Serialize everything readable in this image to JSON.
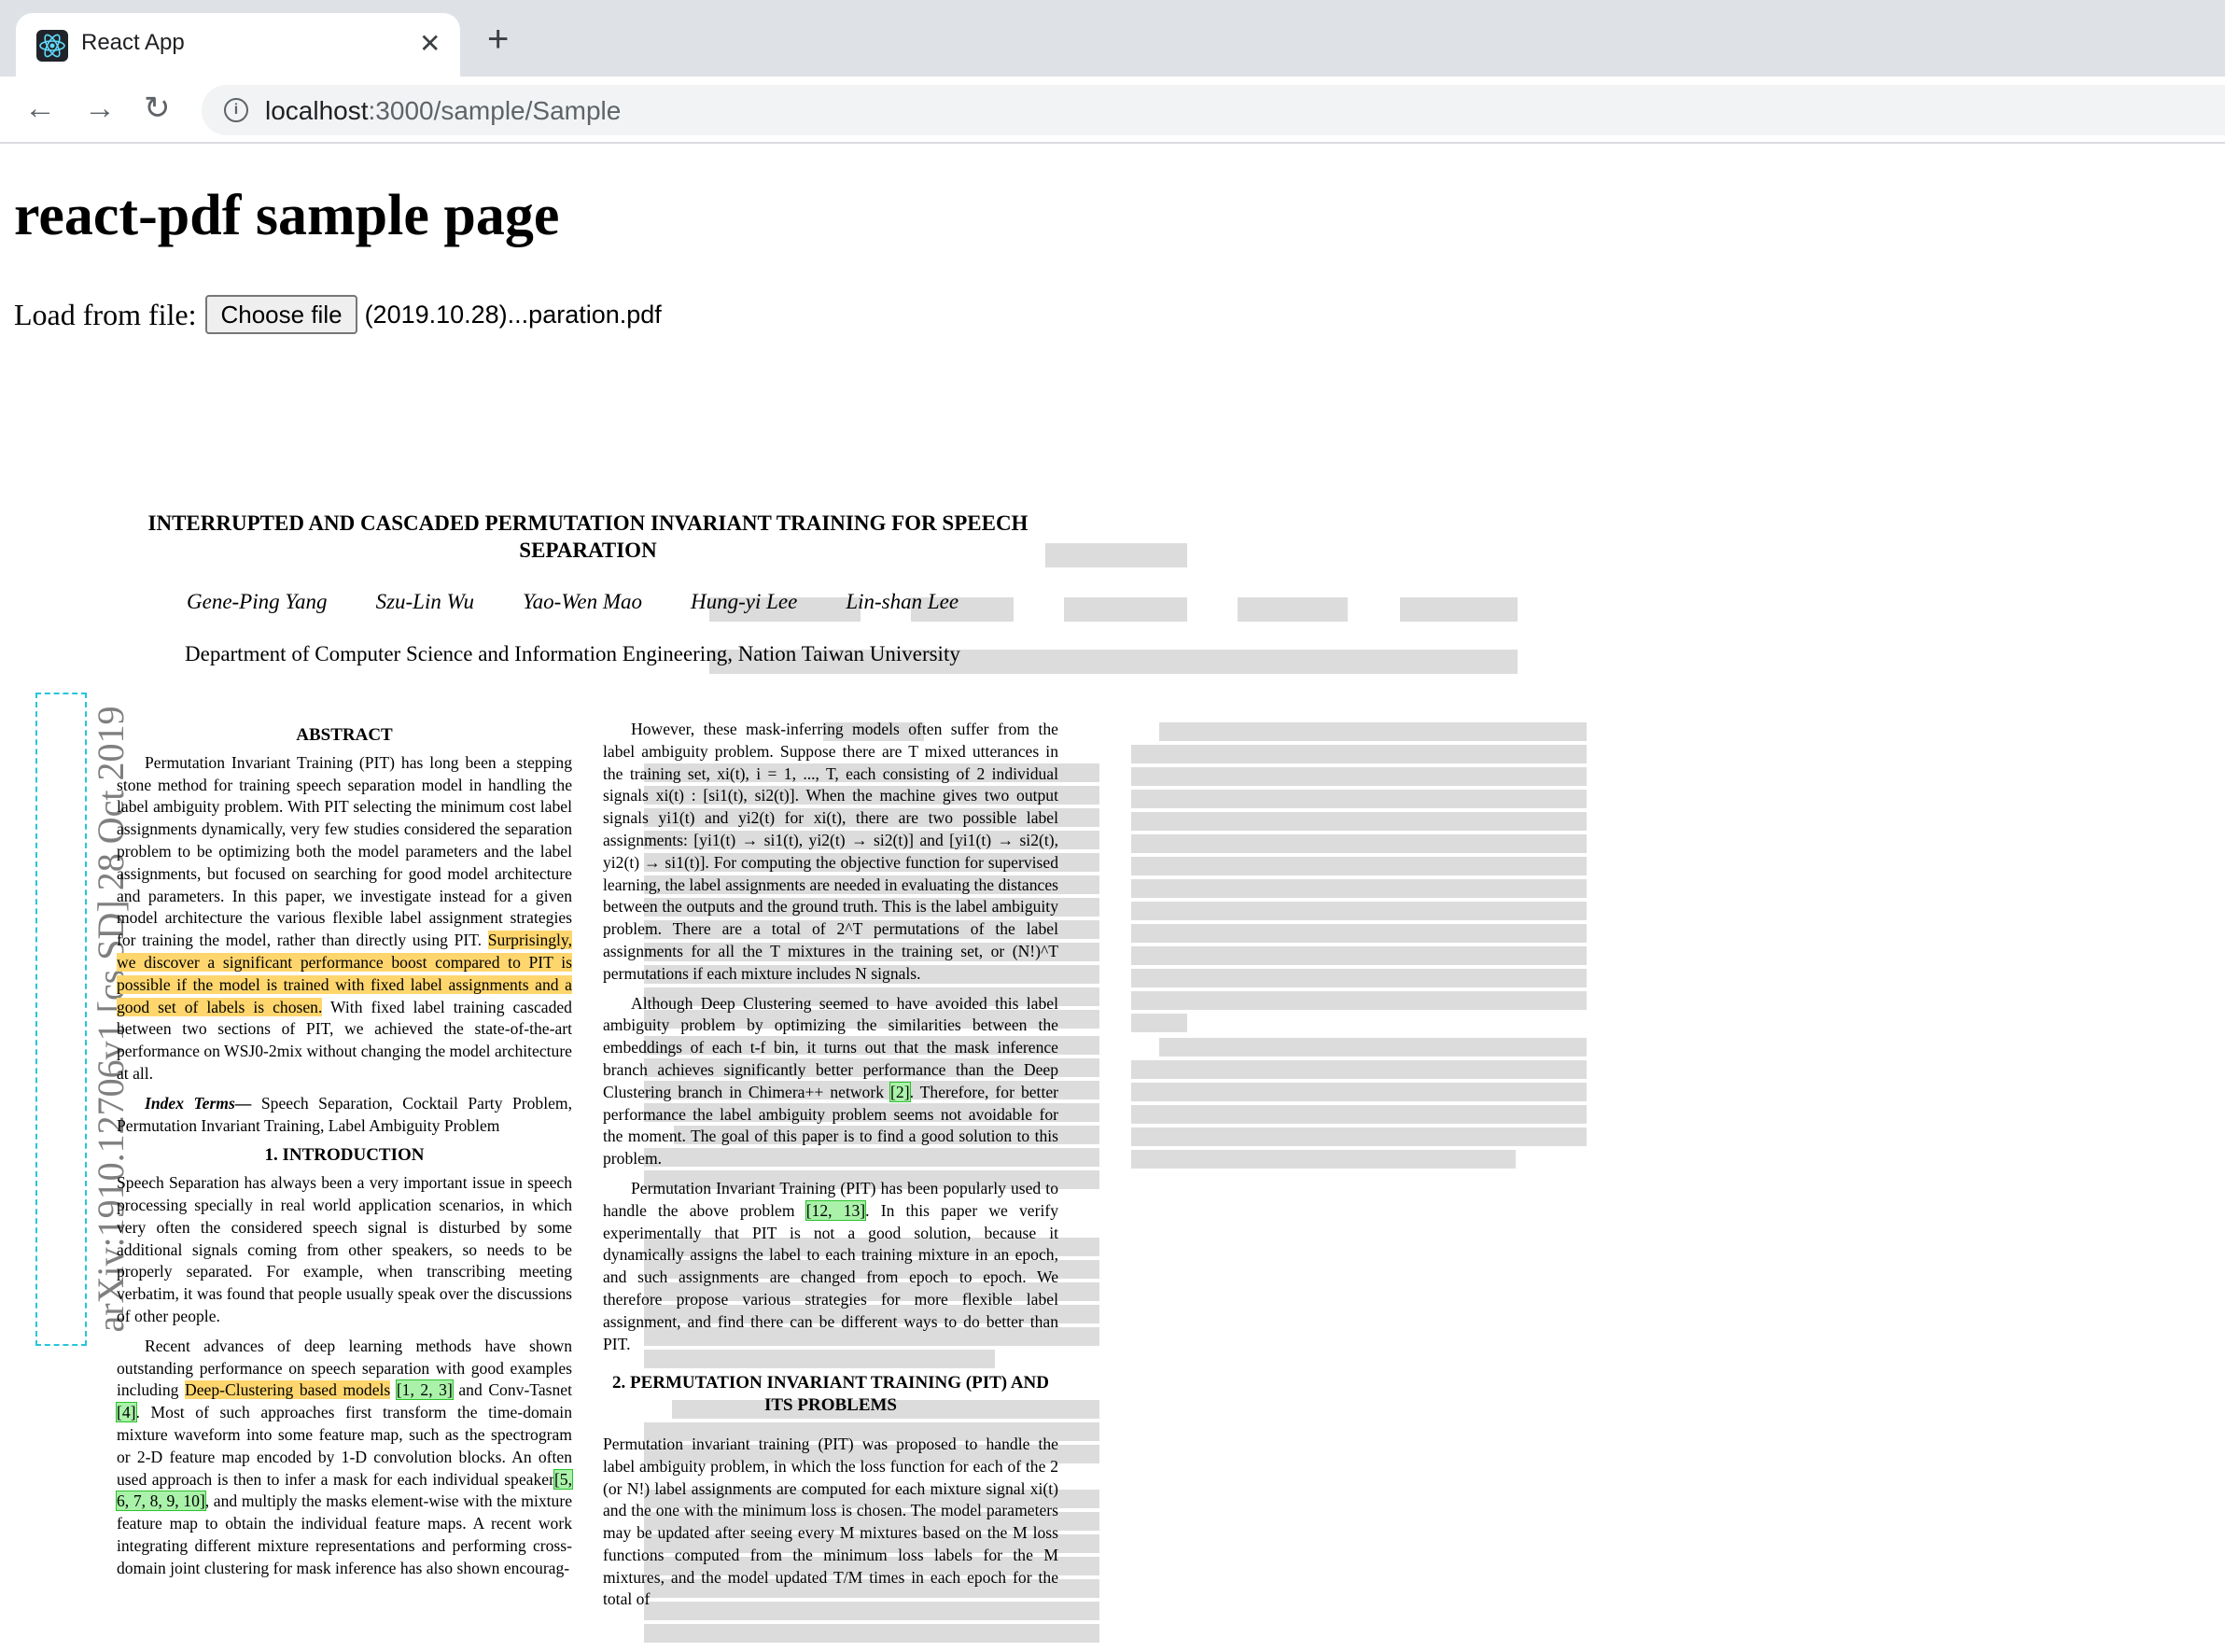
{
  "browser": {
    "tab_title": "React App",
    "url_host": "localhost",
    "url_rest": ":3000/sample/Sample"
  },
  "page": {
    "heading": "react-pdf sample page",
    "load_label": "Load from file:",
    "choose_button": "Choose file",
    "file_name": "(2019.10.28)...paration.pdf"
  },
  "pdf": {
    "arxiv_stamp": "arXiv:1910.12706v1  [cs.SD]  28 Oct 2019",
    "title": "INTERRUPTED AND CASCADED PERMUTATION INVARIANT TRAINING FOR SPEECH SEPARATION",
    "authors": [
      "Gene-Ping Yang",
      "Szu-Lin Wu",
      "Yao-Wen Mao",
      "Hung-yi Lee",
      "Lin-shan Lee"
    ],
    "affiliation": "Department of Computer Science and Information Engineering, Nation Taiwan University",
    "abstract_heading": "ABSTRACT",
    "abstract_a": "Permutation Invariant Training (PIT) has long been a stepping stone method for training speech separation model in handling the label ambiguity problem. With PIT selecting the minimum cost label assignments dynamically, very few studies considered the separation problem to be optimizing both the model parameters and the label assignments, but focused on searching for good model architecture and parameters. In this paper, we investigate instead for a given model architecture the various flexible label assignment strategies for training the model, rather than directly using PIT.",
    "abstract_highlight": "Surprisingly, we discover a significant performance boost compared to PIT is possible if the model is trained with fixed label assignments and a good set of labels is chosen.",
    "abstract_b": "With fixed label training cascaded between two sections of PIT, we achieved the state-of-the-art performance on WSJ0-2mix without changing the model architecture at all.",
    "index_terms_label": "Index Terms—",
    "index_terms": "Speech Separation, Cocktail Party Problem, Permutation Invariant Training, Label Ambiguity Problem",
    "intro_heading": "1.  INTRODUCTION",
    "intro_p1": "Speech Separation has always been a very important issue in speech processing specially in real world application scenarios, in which very often the considered speech signal is disturbed by some additional signals coming from other speakers, so needs to be properly separated.  For example, when transcribing meeting verbatim, it was found that people usually speak over the discussions of other people.",
    "intro_p2a": "Recent advances of deep learning methods have shown outstanding performance on speech separation with good examples including",
    "intro_p2_hl": "Deep-Clustering based models",
    "intro_p2_cite1": "[1, 2, 3]",
    "intro_p2b": "and Conv-Tasnet",
    "intro_p2_cite2": "[4]",
    "intro_p2c": ". Most of such approaches first transform the time-domain mixture waveform into some feature map, such as the spectrogram or 2-D feature map encoded by 1-D convolution blocks. An often used approach is then to infer a mask for each individual speaker",
    "intro_p2_cite3": "[5, 6, 7, 8, 9, 10]",
    "intro_p2d": ", and multiply the masks element-wise with the mixture feature map to obtain the individual feature maps.  A recent work integrating different mixture representations and performing cross-domain joint clustering for mask inference has also shown encourag-",
    "c2_p1": "However, these mask-inferring models often suffer from the label ambiguity problem.  Suppose there are T mixed utterances in the training set, xi(t), i = 1, ..., T, each consisting of 2 individual signals xi(t) : [si1(t), si2(t)].  When the machine gives two output signals yi1(t) and yi2(t) for xi(t), there are two possible label assignments: [yi1(t) → si1(t), yi2(t) → si2(t)] and [yi1(t) → si2(t), yi2(t) → si1(t)].  For computing the objective function for supervised learning, the label assignments are needed in evaluating the distances between the outputs and the ground truth.  This is the label ambiguity problem.  There are a total of 2^T permutations of the label assignments for all the T mixtures in the training set, or (N!)^T permutations if each mixture includes N signals.",
    "c2_p2a": "Although Deep Clustering seemed to have avoided this label ambiguity problem by optimizing the similarities between the embeddings of each t-f bin, it turns out that the mask inference branch achieves significantly better performance than the Deep Clustering branch in Chimera++ network",
    "c2_p2_cite": "[2]",
    "c2_p2b": ".  Therefore, for better performance the label ambiguity problem seems not avoidable for the moment. The goal of this paper is to find a good solution to this problem.",
    "c2_p3a": "Permutation Invariant Training (PIT) has been popularly used to handle the above problem",
    "c2_p3_cite": "[12, 13]",
    "c2_p3b": ". In this paper we verify experimentally that PIT is not a good solution, because it dynamically assigns the label to each training mixture in an epoch, and such assignments are changed from epoch to epoch. We therefore propose various strategies for more flexible label assignment, and find there can be different ways to do better than PIT.",
    "sec2_heading": "2.  PERMUTATION INVARIANT TRAINING (PIT) AND ITS PROBLEMS",
    "c2_p4": "Permutation invariant training (PIT) was proposed to handle the label ambiguity problem, in which the loss function for each of the 2 (or N!) label assignments are computed for each mixture signal xi(t) and the one with the minimum loss is chosen.  The model parameters may be updated after seeing every M mixtures based on the M loss functions computed from the minimum loss labels for the M mixtures, and the model updated T/M times in each epoch for the total of"
  }
}
